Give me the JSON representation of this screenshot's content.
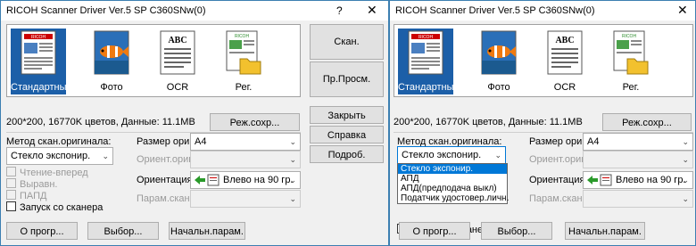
{
  "window_title": "RICOH Scanner Driver Ver.5 SP C360SNw(0)",
  "titlebar_help": "?",
  "titlebar_close": "✕",
  "modes": [
    "Стандартный",
    "Фото",
    "OCR",
    "Рег."
  ],
  "selected_mode": "Стандартный",
  "info": "200*200, 16770K цветов, Данные: 11.1MB",
  "buttons": {
    "scan": "Скан.",
    "preview": "Пр.Просм.",
    "close": "Закрыть",
    "help": "Справка",
    "details": "Подроб.",
    "save_mode": "Реж.сохр...",
    "about": "О прогр...",
    "select": "Выбор...",
    "defaults": "Начальн.парам."
  },
  "labels": {
    "scan_method": "Метод скан.оригинала:",
    "original_size": "Размер ориг.:",
    "original_type": "Ориент.ориг.:",
    "orientation": "Ориентация:",
    "scan_param": "Парам.скан.:"
  },
  "values": {
    "scan_method": "Стекло экспонир.",
    "original_size": "A4",
    "orientation": "Влево на 90 гр."
  },
  "checkboxes": {
    "read_ahead": "Чтение-вперед",
    "align": "Выравн.",
    "papd": "ПАПД",
    "start_from_scanner": "Запуск со сканера"
  },
  "dropdown_options": [
    "Стекло экспонир.",
    "АПД",
    "АПД(предподача выкл)",
    "Податчик удостовер.личн."
  ],
  "thumb_texts": {
    "standard_logo": "RICOH",
    "ocr": "ABC",
    "reg_logo": "RICOH"
  },
  "colors": {
    "selection": "#1c5fa8",
    "highlight": "#0078d7",
    "window_border": "#3c7fb1"
  }
}
